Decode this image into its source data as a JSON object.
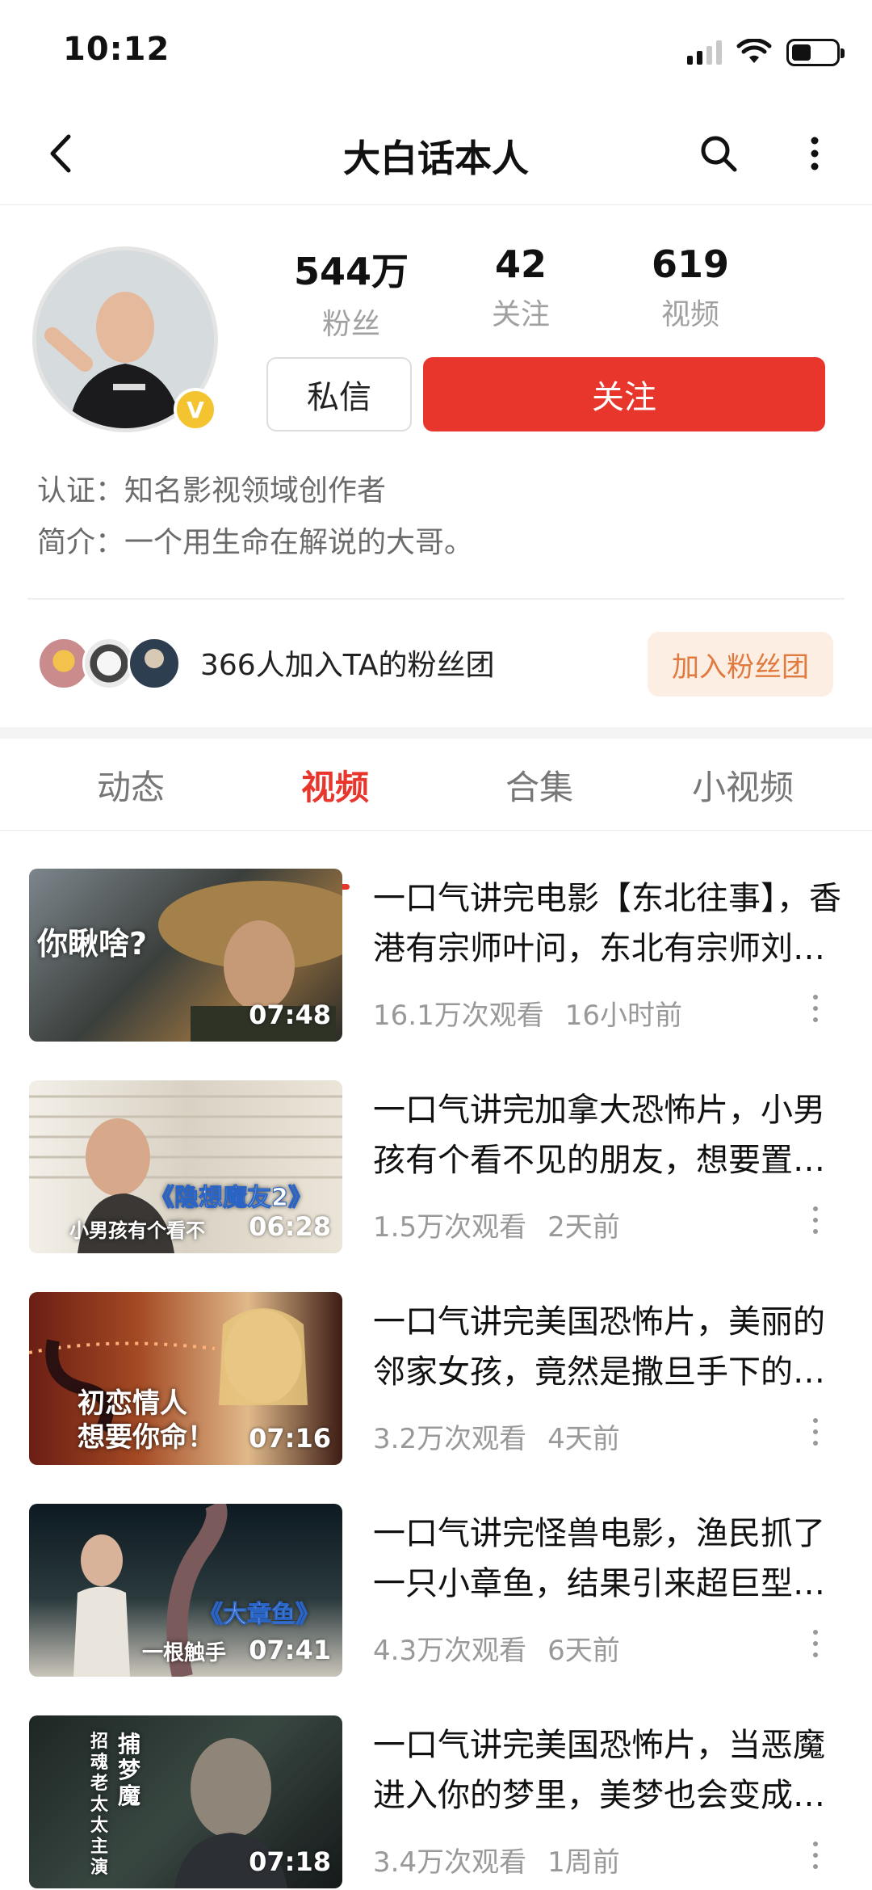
{
  "status_bar": {
    "time": "10:12"
  },
  "nav": {
    "title": "大白话本人"
  },
  "profile": {
    "stats": [
      {
        "value": "544万",
        "label": "粉丝"
      },
      {
        "value": "42",
        "label": "关注"
      },
      {
        "value": "619",
        "label": "视频"
      }
    ],
    "message_label": "私信",
    "follow_label": "关注",
    "certification": "认证：知名影视领域创作者",
    "bio": "简介：一个用生命在解说的大哥。"
  },
  "fan_club": {
    "text": "366人加入TA的粉丝团",
    "join_label": "加入粉丝团"
  },
  "tabs": [
    {
      "label": "动态",
      "active": false
    },
    {
      "label": "视频",
      "active": true
    },
    {
      "label": "合集",
      "active": false
    },
    {
      "label": "小视频",
      "active": false
    }
  ],
  "videos": [
    {
      "title": "一口气讲完电影【东北往事】，香港有宗师叶问，东北有宗师刘海柱",
      "views": "16.1万次观看",
      "time": "16小时前",
      "duration": "07:48",
      "thumb_caption": "你瞅啥?"
    },
    {
      "title": "一口气讲完加拿大恐怖片，小男孩有个看不见的朋友，想要置他于死地",
      "views": "1.5万次观看",
      "time": "2天前",
      "duration": "06:28",
      "thumb_caption": "《隐想魔友2》",
      "thumb_subcaption": "小男孩有个看不"
    },
    {
      "title": "一口气讲完美国恐怖片，美丽的邻家女孩，竟然是撒旦手下的恶魔",
      "views": "3.2万次观看",
      "time": "4天前",
      "duration": "07:16",
      "thumb_caption": "初恋情人",
      "thumb_subcaption": "想要你命！"
    },
    {
      "title": "一口气讲完怪兽电影，渔民抓了一只小章鱼，结果引来超巨型章鱼",
      "views": "4.3万次观看",
      "time": "6天前",
      "duration": "07:41",
      "thumb_caption": "《大章鱼》",
      "thumb_subcaption": "一根触手"
    },
    {
      "title": "一口气讲完美国恐怖片，当恶魔进入你的梦里，美梦也会变成噩梦",
      "views": "3.4万次观看",
      "time": "1周前",
      "duration": "07:18",
      "thumb_caption": "捕梦魔",
      "thumb_subcaption": "招魂老太太主演"
    }
  ],
  "colors": {
    "accent": "#e9362c",
    "join_bg": "#fdeee3",
    "join_text": "#e07a3e"
  },
  "icons": [
    "back-icon",
    "search-icon",
    "more-icon",
    "signal-icon",
    "wifi-icon",
    "battery-icon",
    "verified-icon"
  ]
}
